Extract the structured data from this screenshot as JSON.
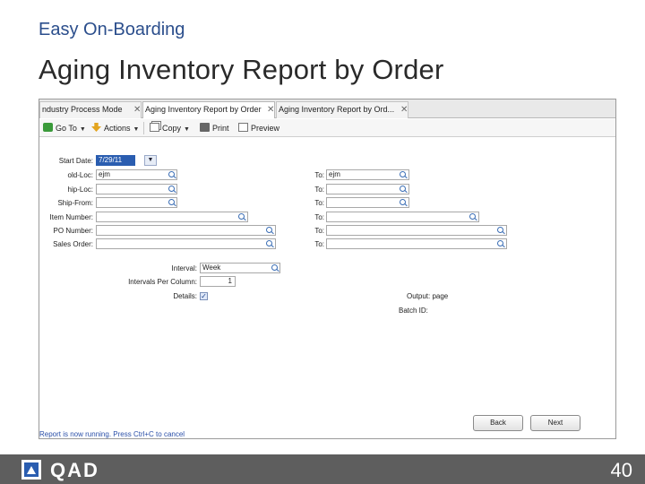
{
  "slide": {
    "kicker": "Easy On-Boarding",
    "title": "Aging Inventory Report by Order",
    "page_number": "40",
    "logo_text": "QAD"
  },
  "tabs": [
    {
      "label": "ndustry Process Mode",
      "close": "✕"
    },
    {
      "label": "Aging Inventory Report by Order",
      "close": "✕"
    },
    {
      "label": "Aging Inventory Report by Ord...",
      "close": "✕"
    }
  ],
  "toolbar": {
    "goto": "Go To",
    "actions": "Actions",
    "copy": "Copy",
    "print": "Print",
    "preview": "Preview",
    "caret": "▼"
  },
  "form": {
    "start_date": {
      "label": "Start Date:",
      "value": "7/29/11",
      "drop": "▼"
    },
    "left_rows": [
      {
        "label": "old-Loc:",
        "value": "ejm"
      },
      {
        "label": "hip-Loc:",
        "value": ""
      },
      {
        "label": "Ship-From:",
        "value": ""
      },
      {
        "label": "Item Number:",
        "value": ""
      },
      {
        "label": "PO Number:",
        "value": ""
      },
      {
        "label": "Sales Order:",
        "value": ""
      }
    ],
    "right_rows": [
      {
        "label": "To:",
        "value": "ejm"
      },
      {
        "label": "To:",
        "value": ""
      },
      {
        "label": "To:",
        "value": ""
      },
      {
        "label": "To:",
        "value": ""
      },
      {
        "label": "To:",
        "value": ""
      },
      {
        "label": "To:",
        "value": ""
      }
    ],
    "interval": {
      "label": "Interval:",
      "value": "Week"
    },
    "intervals_per_column": {
      "label": "Intervals Per Column:",
      "value": "1"
    },
    "details": {
      "label": "Details:",
      "checked": "✓"
    },
    "output": {
      "label": "Output: page"
    },
    "batch_id": {
      "label": "Batch ID:"
    }
  },
  "buttons": {
    "back": "Back",
    "next": "Next"
  },
  "status": "Report is now running. Press Ctrl+C to cancel",
  "colors": {
    "kicker": "#2b4e8c",
    "selection": "#2a5db0",
    "footer": "#5e5e5e"
  }
}
